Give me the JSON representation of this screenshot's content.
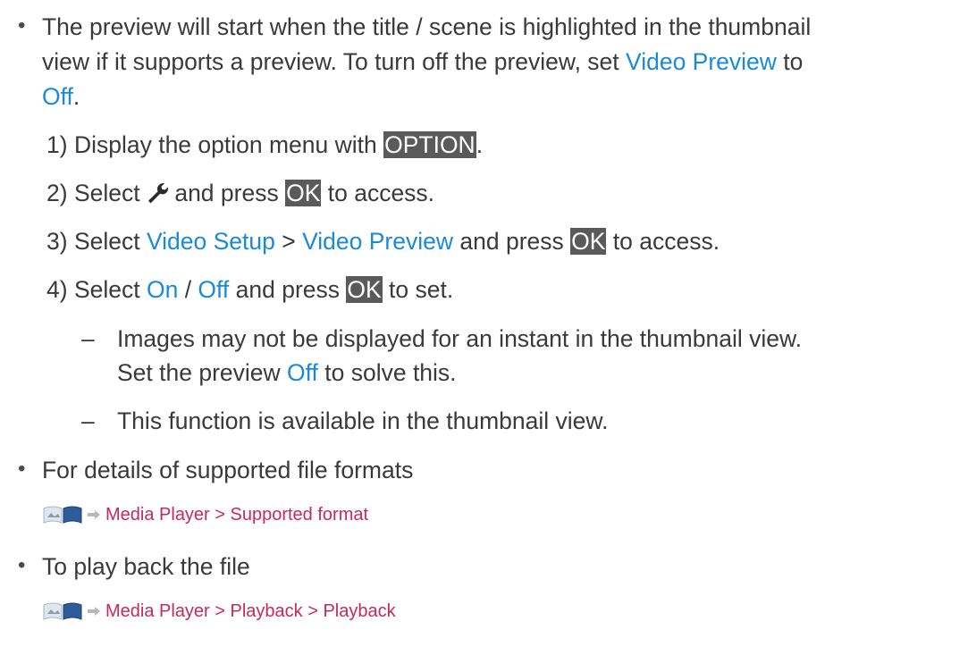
{
  "bullet1": {
    "line1": "The preview will start when the title / scene is highlighted in the thumbnail",
    "line2a": "view if it supports a preview. To turn off the preview, set ",
    "line2b": "Video Preview",
    "line2c": " to",
    "line3a": "Off",
    "line3b": "."
  },
  "steps": [
    {
      "num": "1)",
      "a": "Display the option menu with ",
      "key": "OPTION",
      "b": "."
    },
    {
      "num": "2)",
      "a": "Select ",
      "icon": "wrench-icon",
      "b": " and press ",
      "key": "OK",
      "c": " to access."
    },
    {
      "num": "3)",
      "a": "Select ",
      "link1": "Video Setup",
      "sep": " > ",
      "link2": "Video Preview",
      "b": " and press ",
      "key": "OK",
      "c": " to access."
    },
    {
      "num": "4)",
      "a": "Select ",
      "link1": "On",
      "sep": " / ",
      "link2": "Off",
      "b": " and press ",
      "key": "OK",
      "c": " to set."
    }
  ],
  "notes": [
    {
      "dash": "–",
      "line1": "Images may not be displayed for an instant in the thumbnail view.",
      "line2a": "Set the preview ",
      "line2b": "Off",
      "line2c": " to solve this."
    },
    {
      "dash": "–",
      "line1": "This function is available in the thumbnail view."
    }
  ],
  "bullet2": {
    "text": "For details of supported file formats",
    "ref_icon": "manual-book-icon",
    "ref": "Media Player > Supported format"
  },
  "bullet3": {
    "text": "To play back the file",
    "ref_icon": "manual-book-icon",
    "ref": "Media Player > Playback > Playback"
  },
  "colors": {
    "link": "#1a8ad8",
    "reference": "#c8285a",
    "key_bg": "#5a5a5a"
  }
}
